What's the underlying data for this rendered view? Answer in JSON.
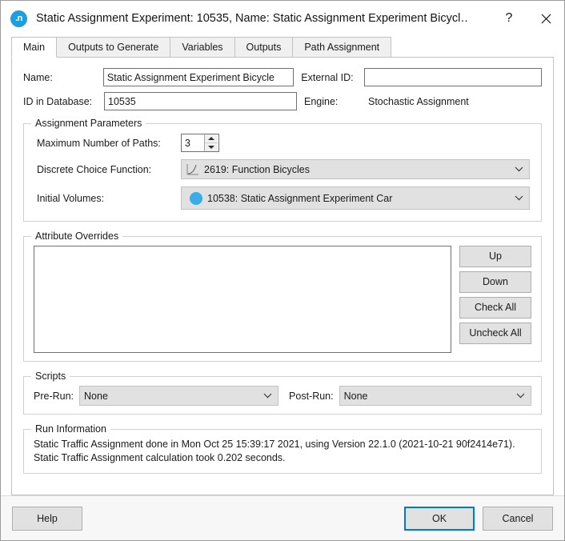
{
  "window": {
    "title": "Static Assignment Experiment: 10535, Name: Static Assignment Experiment Bicycl…",
    "app_icon_label": ".n",
    "help_button": "?",
    "close_button": "✕"
  },
  "tabs": [
    {
      "label": "Main",
      "active": true
    },
    {
      "label": "Outputs to Generate",
      "active": false
    },
    {
      "label": "Variables",
      "active": false
    },
    {
      "label": "Outputs",
      "active": false
    },
    {
      "label": "Path Assignment",
      "active": false
    }
  ],
  "fields": {
    "name_label": "Name:",
    "name_value": "Static Assignment Experiment Bicycle",
    "external_id_label": "External ID:",
    "external_id_value": "",
    "id_in_database_label": "ID in Database:",
    "id_in_database_value": "10535",
    "engine_label": "Engine:",
    "engine_value": "Stochastic Assignment"
  },
  "assignment_parameters": {
    "legend": "Assignment Parameters",
    "max_paths_label": "Maximum Number of Paths:",
    "max_paths_value": "3",
    "discrete_choice_label": "Discrete Choice Function:",
    "discrete_choice_value": "2619: Function Bicycles",
    "discrete_choice_icon": "function-curve-icon",
    "initial_volumes_label": "Initial Volumes:",
    "initial_volumes_value": "10538: Static Assignment Experiment Car",
    "initial_volumes_icon": "blue-circle-icon"
  },
  "attribute_overrides": {
    "legend": "Attribute Overrides",
    "items": [],
    "buttons": [
      {
        "label": "Up",
        "name": "up-button"
      },
      {
        "label": "Down",
        "name": "down-button"
      },
      {
        "label": "Check All",
        "name": "check-all-button"
      },
      {
        "label": "Uncheck All",
        "name": "uncheck-all-button"
      }
    ]
  },
  "scripts": {
    "legend": "Scripts",
    "pre_run_label": "Pre-Run:",
    "pre_run_value": "None",
    "post_run_label": "Post-Run:",
    "post_run_value": "None"
  },
  "run_information": {
    "legend": "Run Information",
    "text": "Static Traffic Assignment done in Mon Oct 25 15:39:17 2021, using Version 22.1.0 (2021-10-21 90f2414e71).\nStatic Traffic Assignment calculation took 0.202 seconds."
  },
  "footer": {
    "help_label": "Help",
    "ok_label": "OK",
    "cancel_label": "Cancel"
  },
  "colors": {
    "accent": "#0078d7",
    "app_icon": "#1c9ee0",
    "object_dot": "#39ade8",
    "control_face": "#e1e1e1"
  }
}
